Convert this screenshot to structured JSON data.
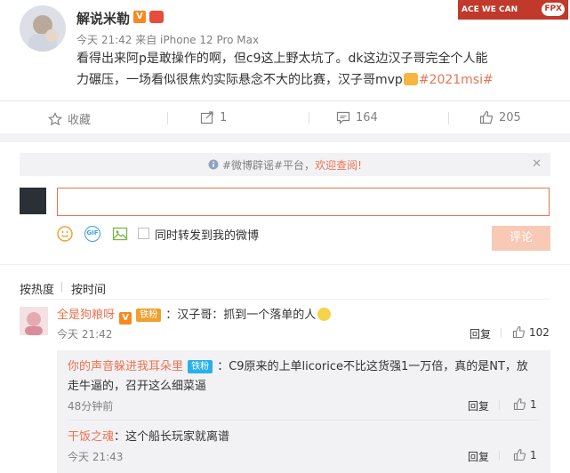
{
  "post": {
    "author": "解说米勒",
    "time": "今天 21:42",
    "source": "来自 iPhone 12 Pro Max",
    "text_main": "看得出来阿p是敢操作的啊，但c9这上野太坑了。dk这边汉子哥完全个人能力碾压，一场看似很焦灼实际悬念不大的比赛，汉子哥mvp",
    "topic": "#2021msi#",
    "banner_text": "ACE WE CAN",
    "banner_tag": "FPX"
  },
  "actions": {
    "favorite": "收藏",
    "repost_count": "1",
    "comment_count": "164",
    "like_count": "205"
  },
  "notice": {
    "prefix": "#微博辟谣#平台，",
    "link": "欢迎查阅!"
  },
  "composer": {
    "placeholder": "",
    "repost_label": "同时转发到我的微博",
    "submit": "评论"
  },
  "sort": {
    "hot": "按热度",
    "time": "按时间"
  },
  "comments": [
    {
      "author": "全是狗粮呀",
      "badge": "铁粉",
      "text": "：汉子哥：抓到一个落单的人",
      "time": "今天 21:42",
      "reply_label": "回复",
      "likes": "102",
      "replies": [
        {
          "author": "你的声音躲进我耳朵里",
          "badge": "铁粉",
          "text": "：C9原来的上单licorice不比这货强1一万倍，真的是NT，放走牛逼的，召开这么细菜逼",
          "time": "48分钟前",
          "reply_label": "回复",
          "likes": "1"
        },
        {
          "author": "干饭之魂",
          "text": "：这个船长玩家就离谱",
          "time": "今天 21:43",
          "reply_label": "回复",
          "likes": "1"
        }
      ]
    }
  ],
  "colors": {
    "accent": "#eb7350",
    "muted": "#808080",
    "panel": "#f2f2f5"
  }
}
